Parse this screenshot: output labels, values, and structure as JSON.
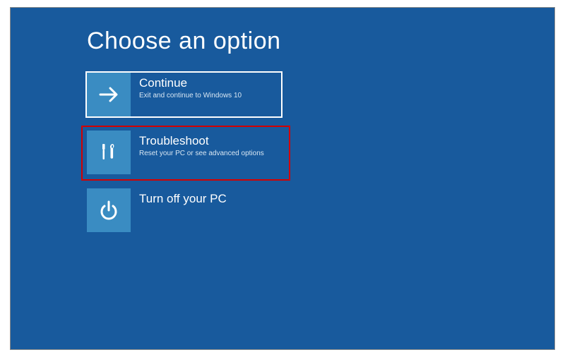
{
  "title": "Choose an option",
  "options": [
    {
      "icon": "arrow-right-icon",
      "title": "Continue",
      "subtitle": "Exit and continue to Windows 10",
      "selected": true
    },
    {
      "icon": "tools-icon",
      "title": "Troubleshoot",
      "subtitle": "Reset your PC or see advanced options",
      "selected": false
    },
    {
      "icon": "power-icon",
      "title": "Turn off your PC",
      "subtitle": "",
      "selected": false
    }
  ],
  "colors": {
    "background": "#185a9d",
    "tile": "#3a8cc2",
    "highlight": "#d40000"
  }
}
